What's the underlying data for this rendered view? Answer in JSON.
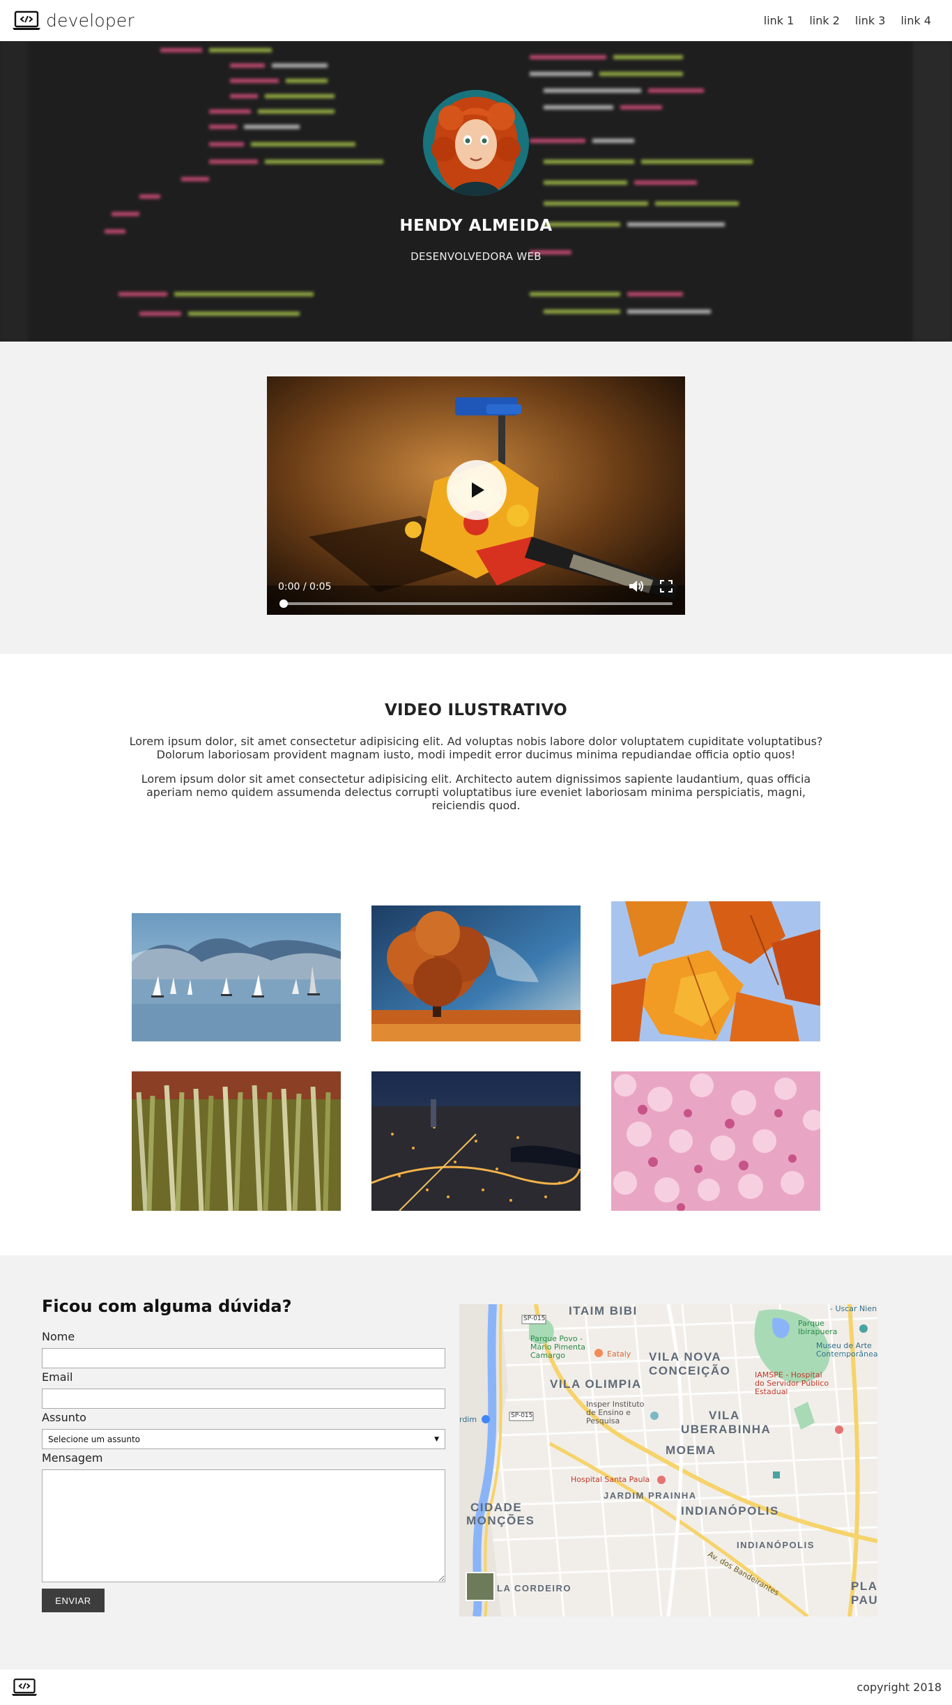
{
  "nav": {
    "brand": "developer",
    "links": [
      "link 1",
      "link 2",
      "link 3",
      "link 4"
    ]
  },
  "hero": {
    "name": "HENDY ALMEIDA",
    "role": "DESENVOLVEDORA WEB"
  },
  "video": {
    "time": "0:00 / 0:05",
    "progress": 0.0
  },
  "section": {
    "title": "VIDEO ILUSTRATIVO",
    "paragraph1": "Lorem ipsum dolor, sit amet consectetur adipisicing elit. Ad voluptas nobis labore dolor voluptatem cupiditate voluptatibus? Dolorum laboriosam provident magnam iusto, modi impedit error ducimus minima repudiandae officia optio quos!",
    "paragraph2": "Lorem ipsum dolor sit amet consectetur adipisicing elit. Architecto autem dignissimos sapiente laudantium, quas officia aperiam nemo quidem assumenda delectus corrupti voluptatibus iure eveniet laboriosam minima perspiciatis, magni, reiciendis quod."
  },
  "contact": {
    "title": "Ficou com alguma dúvida?",
    "name_label": "Nome",
    "email_label": "Email",
    "subject_label": "Assunto",
    "subject_selected": "Selecione um assunto",
    "message_label": "Mensagem",
    "submit": "ENVIAR"
  },
  "map": {
    "labels": [
      "ITAIM BIBI",
      "VILA NOVA",
      "CONCEIÇÃO",
      "VILA OLIMPIA",
      "VILA",
      "UBERABINHA",
      "MOEMA",
      "JARDIM PRAINHA",
      "INDIANÓPOLIS",
      "INDIANÓPOLIS",
      "CIDADE",
      "MONÇÕES",
      "LA CORDEIRO",
      "PLA",
      "PAU"
    ],
    "pois": [
      "Parque Povo - Mário Pimenta Camargo",
      "Eataly",
      "Parque Ibirapuera",
      "Museu de Arte Contemporânea",
      "IAMSPE - Hospital do Servidor Público Estadual",
      "Insper Instituto de Ensino e Pesquisa",
      "Hospital Santa Paula",
      "Av. dos Bandeirantes",
      "SP-015",
      "SP-015",
      "- Uscar Nien",
      "rdim"
    ]
  },
  "footer": {
    "copyright": "copyright 2018"
  },
  "colors": {
    "section_gray": "#f2f2f2",
    "button_dark": "#3d3d3d",
    "hero_dark": "#1f1f1f"
  }
}
